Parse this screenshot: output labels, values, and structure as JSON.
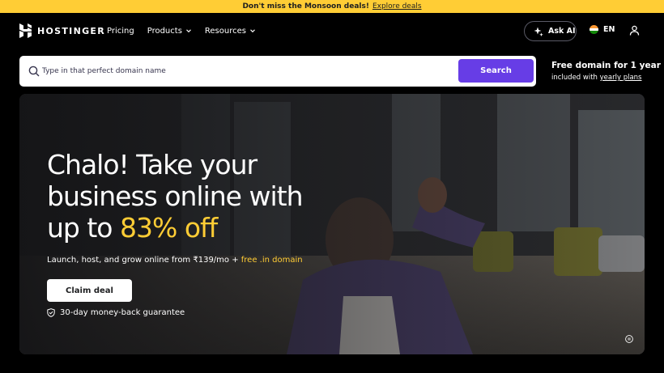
{
  "promo": {
    "text": "Don't miss the Monsoon deals!",
    "link": "Explore deals"
  },
  "nav": {
    "brand": "HOSTINGER",
    "links": [
      {
        "label": "Pricing",
        "has_dropdown": false
      },
      {
        "label": "Products",
        "has_dropdown": true
      },
      {
        "label": "Resources",
        "has_dropdown": true
      }
    ],
    "ask_ai": "Ask AI",
    "language": "EN"
  },
  "search": {
    "placeholder": "Type in that perfect domain name",
    "button": "Search"
  },
  "free_domain": {
    "title": "Free domain for 1 year",
    "subtitle_prefix": "included with",
    "subtitle_link": "yearly plans"
  },
  "hero": {
    "title_part1": "Chalo! Take your business online with up to ",
    "title_accent": "83% off",
    "subtitle_prefix": "Launch, host, and grow online from ₹139/mo + ",
    "subtitle_accent": "free .in domain",
    "cta": "Claim deal",
    "guarantee": "30-day money-back guarantee"
  },
  "colors": {
    "promo_bg": "#ffcd35",
    "accent_yellow": "#ffcd35",
    "primary_purple": "#673de6"
  }
}
